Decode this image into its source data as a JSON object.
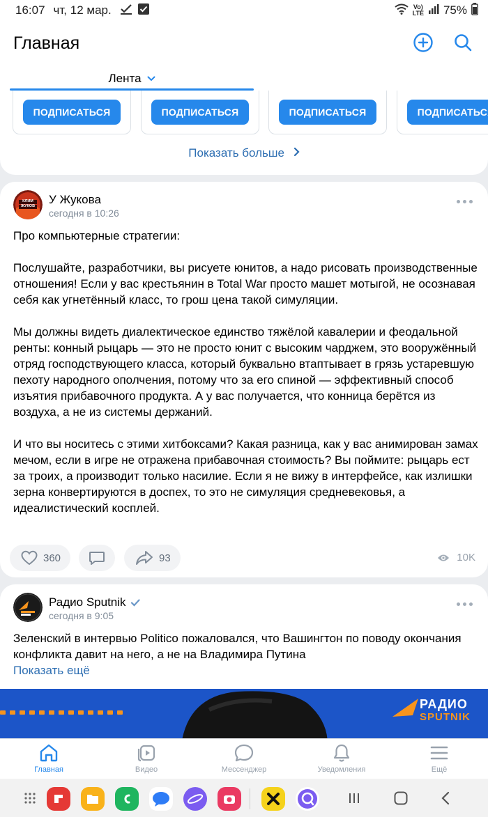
{
  "status_bar": {
    "time": "16:07",
    "date": "чт, 12 мар.",
    "network": "LTE",
    "battery": "75%"
  },
  "header": {
    "title": "Главная",
    "feed_tab": "Лента"
  },
  "recommendations": {
    "subscribe_label": "ПОДПИСАТЬСЯ",
    "show_more": "Показать больше"
  },
  "posts": [
    {
      "author": "У Жукова",
      "time": "сегодня в 10:26",
      "text": "Про компьютерные стратегии:\n\nПослушайте, разработчики, вы рисуете юнитов, а надо рисовать производственные отношения! Если у вас крестьянин в Total War просто машет мотыгой, не осознавая себя как угнетённый класс, то грош цена такой симуляции.\n\nМы должны видеть диалектическое единство тяжёлой кавалерии и феодальной ренты: конный рыцарь — это не просто юнит с высоким чарджем, это вооружённый отряд господствующего класса, который буквально втаптывает в грязь устаревшую пехоту народного ополчения, потому что за его спиной — эффективный способ изъятия прибавочного продукта. А у вас получается, что конница берётся из воздуха, а не из системы держаний.\n\nИ что вы носитесь с этими хитбоксами? Какая разница, как у вас анимирован замах мечом, если в игре не отражена прибавочная стоимость? Вы поймите: рыцарь ест за троих, а производит только насилие. Если я не вижу в интерфейсе, как излишки зерна конвертируются в доспех, то это не симуляция средневековья, а идеалистический косплей.",
      "likes": "360",
      "shares": "93",
      "views": "10K",
      "avatar_text": "КЛИМ ЖУКОВ"
    },
    {
      "author": "Радио Sputnik",
      "time": "сегодня в 9:05",
      "text": "Зеленский в интервью Politico пожаловался, что Вашингтон по поводу окончания конфликта давит на него, а не на Владимира Путина",
      "show_more": "Показать ещё",
      "photo_logo_top": "РАДИО",
      "photo_logo_bottom": "SPUTNIK"
    }
  ],
  "bottom_nav": [
    "Главная",
    "Видео",
    "Мессенджер",
    "Уведомления",
    "Ещё"
  ],
  "colors": {
    "accent": "#2688eb",
    "link": "#2d6eb2",
    "background": "#ebedf0",
    "sputnik_orange": "#f7941d",
    "sputnik_blue": "#1c55c8"
  }
}
